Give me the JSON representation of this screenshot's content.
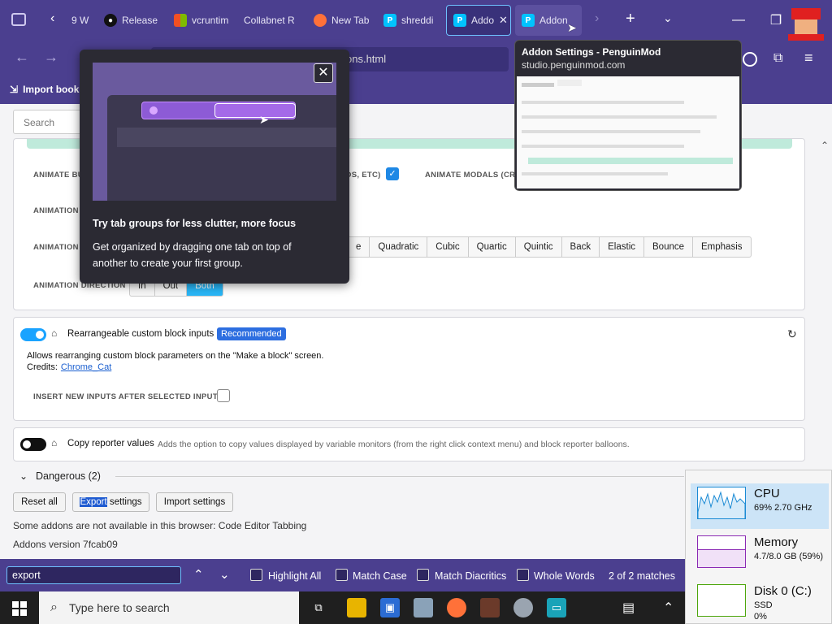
{
  "tabs": [
    {
      "label": "9 W",
      "icon": "page-icon"
    },
    {
      "label": "Release",
      "icon": "github-icon"
    },
    {
      "label": "vcruntim",
      "icon": "microsoft-icon"
    },
    {
      "label": "Collabnet R",
      "icon": "page-icon"
    },
    {
      "label": "New Tab",
      "icon": "firefox-icon"
    },
    {
      "label": "shreddi",
      "icon": "penguinmod-icon"
    },
    {
      "label": "Addo",
      "icon": "penguinmod-icon"
    },
    {
      "label": "Addon",
      "icon": "penguinmod-icon"
    }
  ],
  "url": {
    "visible_text": "ons.html"
  },
  "bookmarks": {
    "import_label": "Import book"
  },
  "search": {
    "placeholder": "Search"
  },
  "tab_groups_popup": {
    "title": "Try tab groups for less clutter, more focus",
    "body": "Get organized by dragging one tab on top of another to create your first group."
  },
  "tab_preview": {
    "title": "Addon Settings - PenguinMod",
    "domain": "studio.penguinmod.com"
  },
  "animation": {
    "animate_bu_label": "ANIMATE BU",
    "os_etc_label": "OS, ETC)",
    "animate_modals_label": "ANIMATE MODALS (CRE",
    "animation_1_label": "ANIMATION",
    "animation_2_label": "ANIMATION",
    "easing_options": [
      "e",
      "Quadratic",
      "Cubic",
      "Quartic",
      "Quintic",
      "Back",
      "Elastic",
      "Bounce",
      "Emphasis"
    ],
    "direction_label": "ANIMATION DIRECTION",
    "direction_options": [
      "In",
      "Out",
      "Both"
    ],
    "direction_selected": "Both"
  },
  "rearrangeable": {
    "title": "Rearrangeable custom block inputs",
    "badge": "Recommended",
    "description": "Allows rearranging custom block parameters on the \"Make a block\" screen.",
    "credits_label": "Credits:",
    "credits_link": "Chrome_Cat",
    "option_label": "INSERT NEW INPUTS AFTER SELECTED INPUT"
  },
  "copy_reporter": {
    "title": "Copy reporter values",
    "description": "Adds the option to copy values displayed by variable monitors (from the right click context menu) and block reporter balloons."
  },
  "dangerous": {
    "label": "Dangerous (2)"
  },
  "footer_buttons": {
    "reset": "Reset all",
    "export_highlight": "Export",
    "export_rest": " settings",
    "import": "Import settings"
  },
  "footer_text": {
    "unavailable": "Some addons are not available in this browser: Code Editor Tabbing",
    "version": "Addons version 7fcab09"
  },
  "findbar": {
    "query": "export",
    "highlight_all": "Highlight All",
    "match_case": "Match Case",
    "match_diacritics": "Match Diacritics",
    "whole_words": "Whole Words",
    "status": "2 of 2 matches"
  },
  "taskbar": {
    "search_placeholder": "Type here to search"
  },
  "taskmgr": {
    "cpu_label": "CPU",
    "cpu_value": "69% 2.70 GHz",
    "memory_label": "Memory",
    "memory_value": "4.7/8.0 GB (59%)",
    "disk_label": "Disk 0 (C:)",
    "disk_type": "SSD",
    "disk_value": "0%"
  },
  "colors": {
    "accent": "#4b3f8f",
    "toggle_on": "#1aa3ff",
    "badge": "#2d6ee0",
    "selected_seg": "#29b6f6"
  }
}
